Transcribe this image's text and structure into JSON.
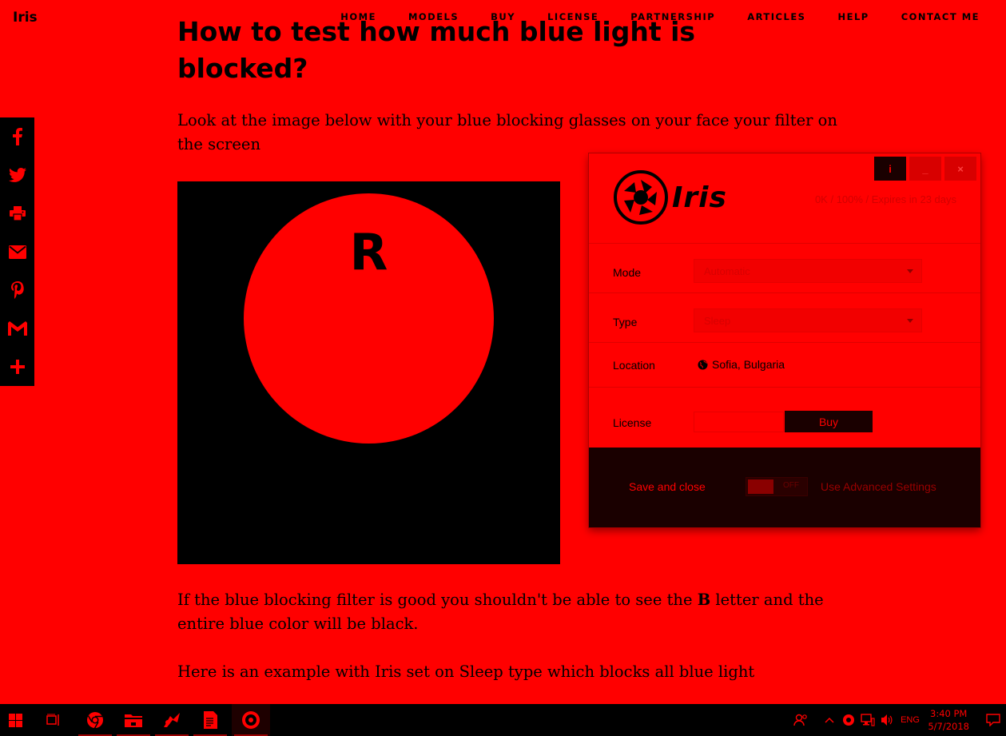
{
  "site": {
    "logo": "Iris",
    "nav": [
      "HOME",
      "MODELS",
      "BUY",
      "LICENSE",
      "PARTNERSHIP",
      "ARTICLES",
      "HELP",
      "CONTACT ME"
    ]
  },
  "article": {
    "heading_line1": "How to test how much blue light is",
    "heading_line2": "blocked?",
    "intro": "Look at the image below with your blue blocking glasses on your face your filter on the screen",
    "test_letter": "R",
    "para2_before": "If the blue blocking filter is good you shouldn't be able to see the ",
    "para2_bold": "B",
    "para2_after": " letter and the entire blue color will be black.",
    "para3": "Here is an example with Iris set on Sleep type which blocks all blue light"
  },
  "share": {
    "icons": [
      "facebook-icon",
      "twitter-icon",
      "print-icon",
      "email-icon",
      "pinterest-icon",
      "gmail-icon",
      "more-icon"
    ]
  },
  "iris_app": {
    "brand": "Iris",
    "status": "0K / 100% / Expires in 23 days",
    "window_buttons": {
      "info": "i",
      "minimize": "_",
      "close": "×"
    },
    "mode_label": "Mode",
    "mode_value": "Automatic",
    "type_label": "Type",
    "type_value": "Sleep",
    "location_label": "Location",
    "location_value": "Sofia, Bulgaria",
    "license_label": "License",
    "license_value": "",
    "buy_label": "Buy",
    "save_label": "Save and close",
    "toggle_state": "OFF",
    "advanced_label": "Use Advanced Settings"
  },
  "taskbar": {
    "language": "ENG",
    "time": "3:40 PM",
    "date": "5/7/2018",
    "apps": [
      "start-icon",
      "task-view-icon",
      "chrome-icon",
      "file-explorer-icon",
      "app-icon",
      "document-app-icon",
      "iris-app-icon"
    ]
  },
  "colors": {
    "background": "#ff0000",
    "ink": "#000000",
    "panel_dark": "#1a0000"
  }
}
